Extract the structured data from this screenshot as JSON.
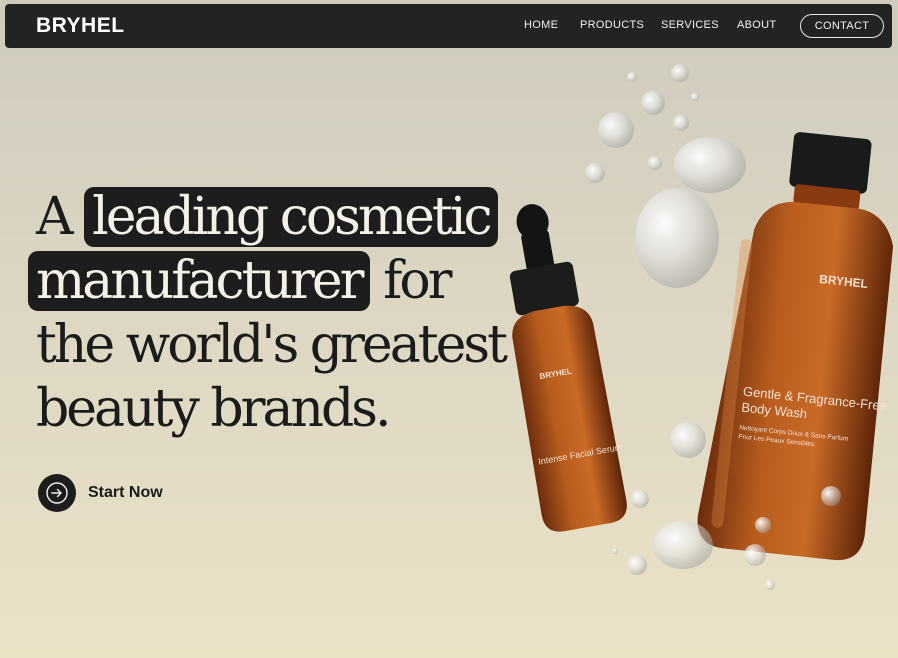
{
  "nav": {
    "brand": "BRYHEL",
    "links": [
      "HOME",
      "PRODUCTS",
      "SERVICES",
      "ABOUT"
    ],
    "contact": "CONTACT"
  },
  "hero": {
    "line1": {
      "plain": "A",
      "highlight": "leading cosmetic"
    },
    "line2": {
      "highlight": "manufacturer",
      "plain": "for"
    },
    "line3": "the world's greatest",
    "line4": "beauty brands."
  },
  "cta": {
    "label": "Start Now",
    "icon": "arrow-right-icon"
  },
  "products": {
    "serum": {
      "brand": "BRYHEL",
      "name": "Intense Facial Serum"
    },
    "bodywash": {
      "brand": "BRYHEL",
      "name_line1": "Gentle & Fragrance-Free",
      "name_line2": "Body Wash",
      "sub_line1": "Nettoyant Corps Doux & Sans Parfum",
      "sub_line2": "Pour Les Peaux Sensibles"
    }
  },
  "colors": {
    "nav_bg": "#232323",
    "highlight_bg": "#1d1d1d",
    "bottle_amber": "#b35a1d"
  }
}
